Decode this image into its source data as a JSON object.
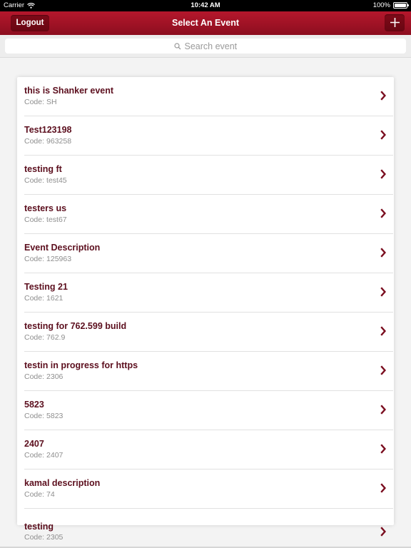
{
  "status_bar": {
    "carrier": "Carrier",
    "time": "10:42 AM",
    "battery": "100%",
    "battery_level": 1.0
  },
  "nav": {
    "logout_label": "Logout",
    "title": "Select An Event"
  },
  "search": {
    "placeholder": "Search event"
  },
  "code_label": "Code:",
  "events": [
    {
      "name": "this is Shanker event",
      "code": "SH"
    },
    {
      "name": "Test123198",
      "code": "963258"
    },
    {
      "name": "testing ft",
      "code": "test45"
    },
    {
      "name": "testers us",
      "code": "test67"
    },
    {
      "name": "Event Description",
      "code": "125963"
    },
    {
      "name": "Testing 21",
      "code": "1621"
    },
    {
      "name": "testing for 762.599 build",
      "code": "762.9"
    },
    {
      "name": "testin in progress for https",
      "code": "2306"
    },
    {
      "name": "5823",
      "code": "5823"
    },
    {
      "name": "2407",
      "code": "2407"
    },
    {
      "name": "kamal description",
      "code": "74"
    },
    {
      "name": "testing",
      "code": "2305"
    }
  ],
  "colors": {
    "nav_red": "#b5172c",
    "nav_red_dark": "#8c0e1f",
    "title_maroon": "#5c0f1e",
    "chevron": "#7a0d1f",
    "code_gray": "#8e8e8e"
  },
  "icons": {
    "wifi": "wifi-icon",
    "battery": "battery-icon",
    "add": "plus-icon",
    "search": "search-icon",
    "chevron": "chevron-right-icon"
  }
}
